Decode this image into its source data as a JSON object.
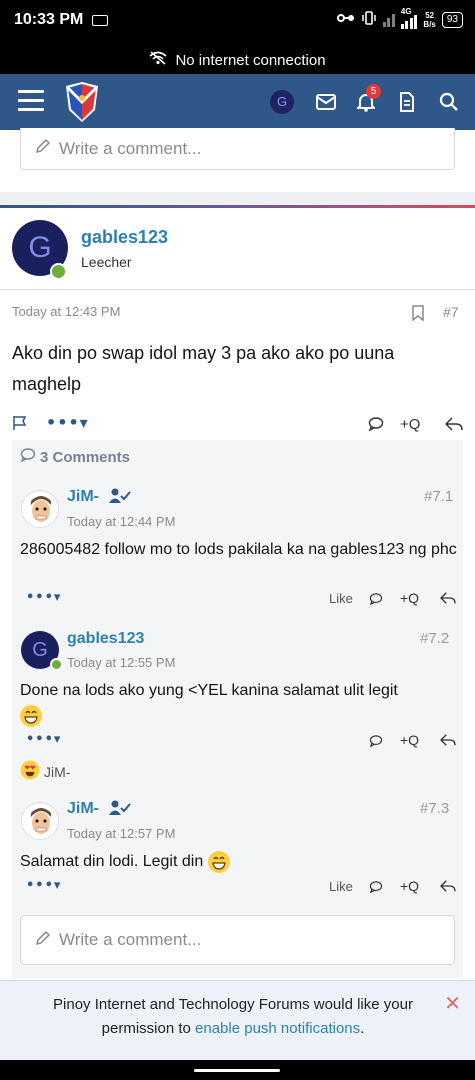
{
  "status_bar": {
    "time": "10:33 PM",
    "network_top": "4G",
    "speed_top": "52",
    "speed_unit": "B/s",
    "battery": "93"
  },
  "offline_banner": {
    "text": "No internet connection"
  },
  "header": {
    "avatar_initial": "G",
    "notification_count": "5"
  },
  "top_comment": {
    "placeholder": "Write a comment..."
  },
  "post": {
    "author": "gables123",
    "author_initial": "G",
    "author_title": "Leecher",
    "timestamp": "Today at 12:43 PM",
    "number": "#7",
    "body": "Ako din po swap idol may 3 pa ako ako po uuna maghelp",
    "quote_label": "+Q"
  },
  "comments_section": {
    "count_label": "3 Comments",
    "comments": [
      {
        "author": "JiM-",
        "timestamp": "Today at 12:44 PM",
        "number": "#7.1",
        "text": "286005482 follow mo to lods pakilala ka na gables123 ng phc",
        "like_label": "Like",
        "quote_label": "+Q"
      },
      {
        "author": "gables123",
        "author_initial": "G",
        "timestamp": "Today at 12:55 PM",
        "number": "#7.2",
        "text": "Done na lods ako yung <YEL kanina salamat ulit legit",
        "quote_label": "+Q",
        "reaction_user": "JiM-"
      },
      {
        "author": "JiM-",
        "timestamp": "Today at 12:57 PM",
        "number": "#7.3",
        "text": "Salamat din lodi. Legit din",
        "like_label": "Like",
        "quote_label": "+Q"
      }
    ],
    "reply_placeholder": "Write a comment..."
  },
  "push_banner": {
    "text_before": "Pinoy Internet and Technology Forums would like your permission to ",
    "link_text": "enable push notifications",
    "text_after": "."
  },
  "colors": {
    "header_bg": "#2f5788",
    "link_blue": "#2f7fb0",
    "online_green": "#6aae3b",
    "badge_red": "#e03b3b"
  },
  "icons": [
    "hamburger-icon",
    "logo",
    "mail-icon",
    "bell-icon",
    "document-icon",
    "search-icon",
    "pencil-icon",
    "bookmark-icon",
    "flag-icon",
    "comment-icon",
    "share-icon",
    "verified-user-icon",
    "emoji-grin-icon",
    "emoji-heart-eyes-icon",
    "close-icon",
    "wifi-off-icon"
  ]
}
